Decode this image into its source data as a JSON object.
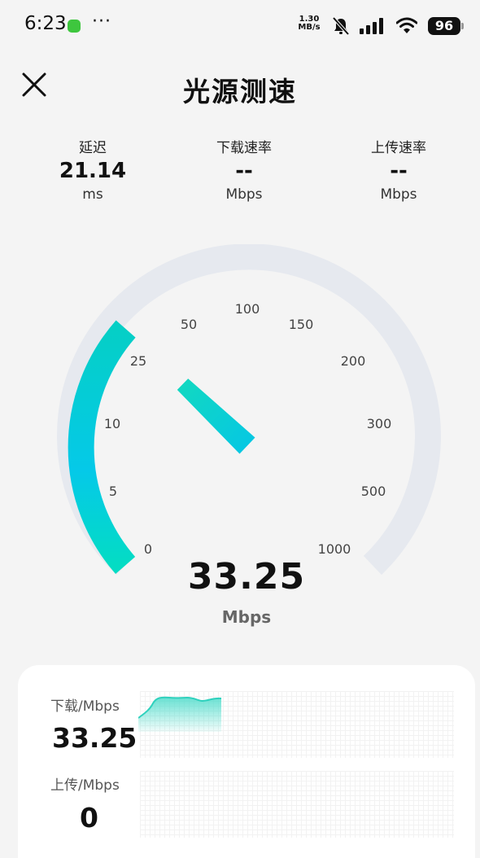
{
  "status_bar": {
    "time": "6:23",
    "more": "···",
    "net_speed_value": "1.30",
    "net_speed_unit": "MB/s",
    "battery": "96"
  },
  "header": {
    "title": "光源测速"
  },
  "metrics": [
    {
      "label": "延迟",
      "value": "21.14",
      "unit": "ms"
    },
    {
      "label": "下载速率",
      "value": "--",
      "unit": "Mbps"
    },
    {
      "label": "上传速率",
      "value": "--",
      "unit": "Mbps"
    }
  ],
  "gauge": {
    "scale_labels": [
      "0",
      "5",
      "10",
      "25",
      "50",
      "100",
      "150",
      "200",
      "300",
      "500",
      "1000"
    ],
    "current_value": "33.25",
    "unit": "Mbps",
    "track_color": "#e6e9ef",
    "progress_color_start": "#04d7c2",
    "progress_color_end": "#05c9e8"
  },
  "results": {
    "download_label": "下载/Mbps",
    "download_value": "33.25",
    "upload_label": "上传/Mbps",
    "upload_value": "0",
    "sparkline_color": "#3fd9c9"
  }
}
